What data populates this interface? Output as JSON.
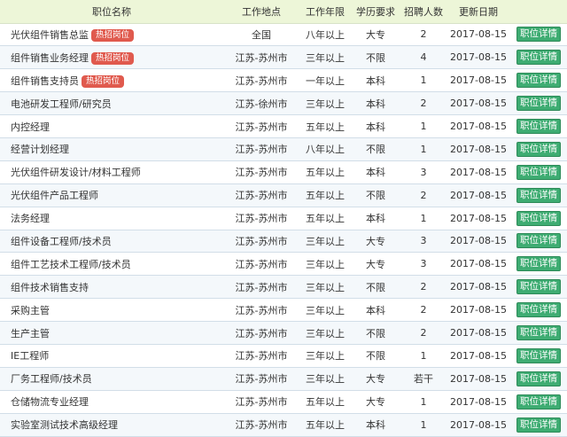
{
  "headers": {
    "title": "职位名称",
    "location": "工作地点",
    "experience": "工作年限",
    "education": "学历要求",
    "headcount": "招聘人数",
    "updated": "更新日期"
  },
  "hot_label": "热招岗位",
  "detail_label": "职位详情",
  "jobs": [
    {
      "title": "光伏组件销售总监",
      "hot": true,
      "location": "全国",
      "experience": "八年以上",
      "education": "大专",
      "headcount": "2",
      "updated": "2017-08-15"
    },
    {
      "title": "组件销售业务经理",
      "hot": true,
      "location": "江苏-苏州市",
      "experience": "三年以上",
      "education": "不限",
      "headcount": "4",
      "updated": "2017-08-15"
    },
    {
      "title": "组件销售支持员",
      "hot": true,
      "location": "江苏-苏州市",
      "experience": "一年以上",
      "education": "本科",
      "headcount": "1",
      "updated": "2017-08-15"
    },
    {
      "title": "电池研发工程师/研究员",
      "hot": false,
      "location": "江苏-徐州市",
      "experience": "三年以上",
      "education": "本科",
      "headcount": "2",
      "updated": "2017-08-15"
    },
    {
      "title": "内控经理",
      "hot": false,
      "location": "江苏-苏州市",
      "experience": "五年以上",
      "education": "本科",
      "headcount": "1",
      "updated": "2017-08-15"
    },
    {
      "title": "经营计划经理",
      "hot": false,
      "location": "江苏-苏州市",
      "experience": "八年以上",
      "education": "不限",
      "headcount": "1",
      "updated": "2017-08-15"
    },
    {
      "title": "光伏组件研发设计/材料工程师",
      "hot": false,
      "location": "江苏-苏州市",
      "experience": "五年以上",
      "education": "本科",
      "headcount": "3",
      "updated": "2017-08-15"
    },
    {
      "title": "光伏组件产品工程师",
      "hot": false,
      "location": "江苏-苏州市",
      "experience": "五年以上",
      "education": "不限",
      "headcount": "2",
      "updated": "2017-08-15"
    },
    {
      "title": "法务经理",
      "hot": false,
      "location": "江苏-苏州市",
      "experience": "五年以上",
      "education": "本科",
      "headcount": "1",
      "updated": "2017-08-15"
    },
    {
      "title": "组件设备工程师/技术员",
      "hot": false,
      "location": "江苏-苏州市",
      "experience": "三年以上",
      "education": "大专",
      "headcount": "3",
      "updated": "2017-08-15"
    },
    {
      "title": "组件工艺技术工程师/技术员",
      "hot": false,
      "location": "江苏-苏州市",
      "experience": "三年以上",
      "education": "大专",
      "headcount": "3",
      "updated": "2017-08-15"
    },
    {
      "title": "组件技术销售支持",
      "hot": false,
      "location": "江苏-苏州市",
      "experience": "三年以上",
      "education": "不限",
      "headcount": "2",
      "updated": "2017-08-15"
    },
    {
      "title": "采购主管",
      "hot": false,
      "location": "江苏-苏州市",
      "experience": "三年以上",
      "education": "本科",
      "headcount": "2",
      "updated": "2017-08-15"
    },
    {
      "title": "生产主管",
      "hot": false,
      "location": "江苏-苏州市",
      "experience": "三年以上",
      "education": "不限",
      "headcount": "2",
      "updated": "2017-08-15"
    },
    {
      "title": "IE工程师",
      "hot": false,
      "location": "江苏-苏州市",
      "experience": "三年以上",
      "education": "不限",
      "headcount": "1",
      "updated": "2017-08-15"
    },
    {
      "title": "厂务工程师/技术员",
      "hot": false,
      "location": "江苏-苏州市",
      "experience": "三年以上",
      "education": "大专",
      "headcount": "若干",
      "updated": "2017-08-15"
    },
    {
      "title": "仓储物流专业经理",
      "hot": false,
      "location": "江苏-苏州市",
      "experience": "五年以上",
      "education": "大专",
      "headcount": "1",
      "updated": "2017-08-15"
    },
    {
      "title": "实验室测试技术高级经理",
      "hot": false,
      "location": "江苏-苏州市",
      "experience": "五年以上",
      "education": "本科",
      "headcount": "1",
      "updated": "2017-08-15"
    }
  ]
}
